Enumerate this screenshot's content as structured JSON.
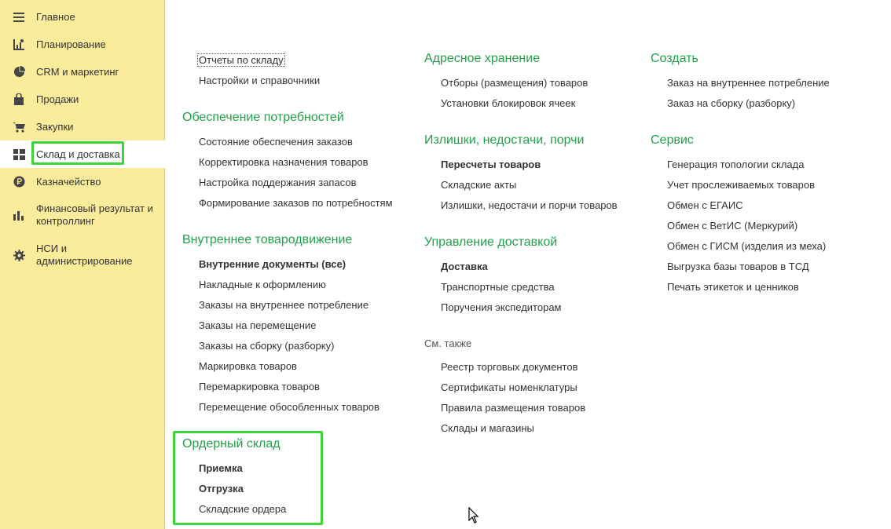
{
  "sidebar": {
    "items": [
      {
        "label": "Главное",
        "icon": "menu-lines-icon"
      },
      {
        "label": "Планирование",
        "icon": "planning-chart-icon"
      },
      {
        "label": "CRM и маркетинг",
        "icon": "pie-chart-icon"
      },
      {
        "label": "Продажи",
        "icon": "shopping-bag-icon"
      },
      {
        "label": "Закупки",
        "icon": "shopping-cart-icon"
      },
      {
        "label": "Склад и доставка",
        "icon": "warehouse-grid-icon"
      },
      {
        "label": "Казначейство",
        "icon": "ruble-coin-icon"
      },
      {
        "label": "Финансовый результат и контроллинг",
        "icon": "bar-chart-icon"
      },
      {
        "label": "НСИ и администрирование",
        "icon": "gear-icon"
      }
    ]
  },
  "content": {
    "top_links": [
      "Отчеты по складу",
      "Настройки и справочники"
    ],
    "provision": {
      "title": "Обеспечение потребностей",
      "links": [
        "Состояние обеспечения заказов",
        "Корректировка назначения товаров",
        "Настройка поддержания запасов",
        "Формирование заказов по потребностям"
      ]
    },
    "internal": {
      "title": "Внутреннее товародвижение",
      "links": [
        "Внутренние документы (все)",
        "Накладные к оформлению",
        "Заказы на внутреннее потребление",
        "Заказы на перемещение",
        "Заказы на сборку (разборку)",
        "Маркировка товаров",
        "Перемаркировка товаров",
        "Перемещение обособленных товаров"
      ]
    },
    "order_warehouse": {
      "title": "Ордерный склад",
      "links": [
        "Приемка",
        "Отгрузка",
        "Складские ордера"
      ]
    },
    "address_storage": {
      "title": "Адресное хранение",
      "links": [
        "Отборы (размещения) товаров",
        "Установки блокировок ячеек"
      ]
    },
    "surplus": {
      "title": "Излишки, недостачи, порчи",
      "links": [
        "Пересчеты товаров",
        "Складские акты",
        "Излишки, недостачи и порчи товаров"
      ]
    },
    "delivery": {
      "title": "Управление доставкой",
      "links": [
        "Доставка",
        "Транспортные средства",
        "Поручения экспедиторам"
      ]
    },
    "see_also": {
      "title": "См. также",
      "links": [
        "Реестр торговых документов",
        "Сертификаты номенклатуры",
        "Правила размещения товаров",
        "Склады и магазины"
      ]
    },
    "create": {
      "title": "Создать",
      "links": [
        "Заказ на внутреннее потребление",
        "Заказ на сборку (разборку)"
      ]
    },
    "service": {
      "title": "Сервис",
      "links": [
        "Генерация топологии склада",
        "Учет прослеживаемых товаров",
        "Обмен с ЕГАИС",
        "Обмен с ВетИС (Меркурий)",
        "Обмен с ГИСМ (изделия из меха)",
        "Выгрузка базы товаров в ТСД",
        "Печать этикеток и ценников"
      ]
    }
  },
  "colors": {
    "sidebar_bg": "#fbec9c",
    "section_title": "#21a14a",
    "highlight": "#3fd43a"
  }
}
